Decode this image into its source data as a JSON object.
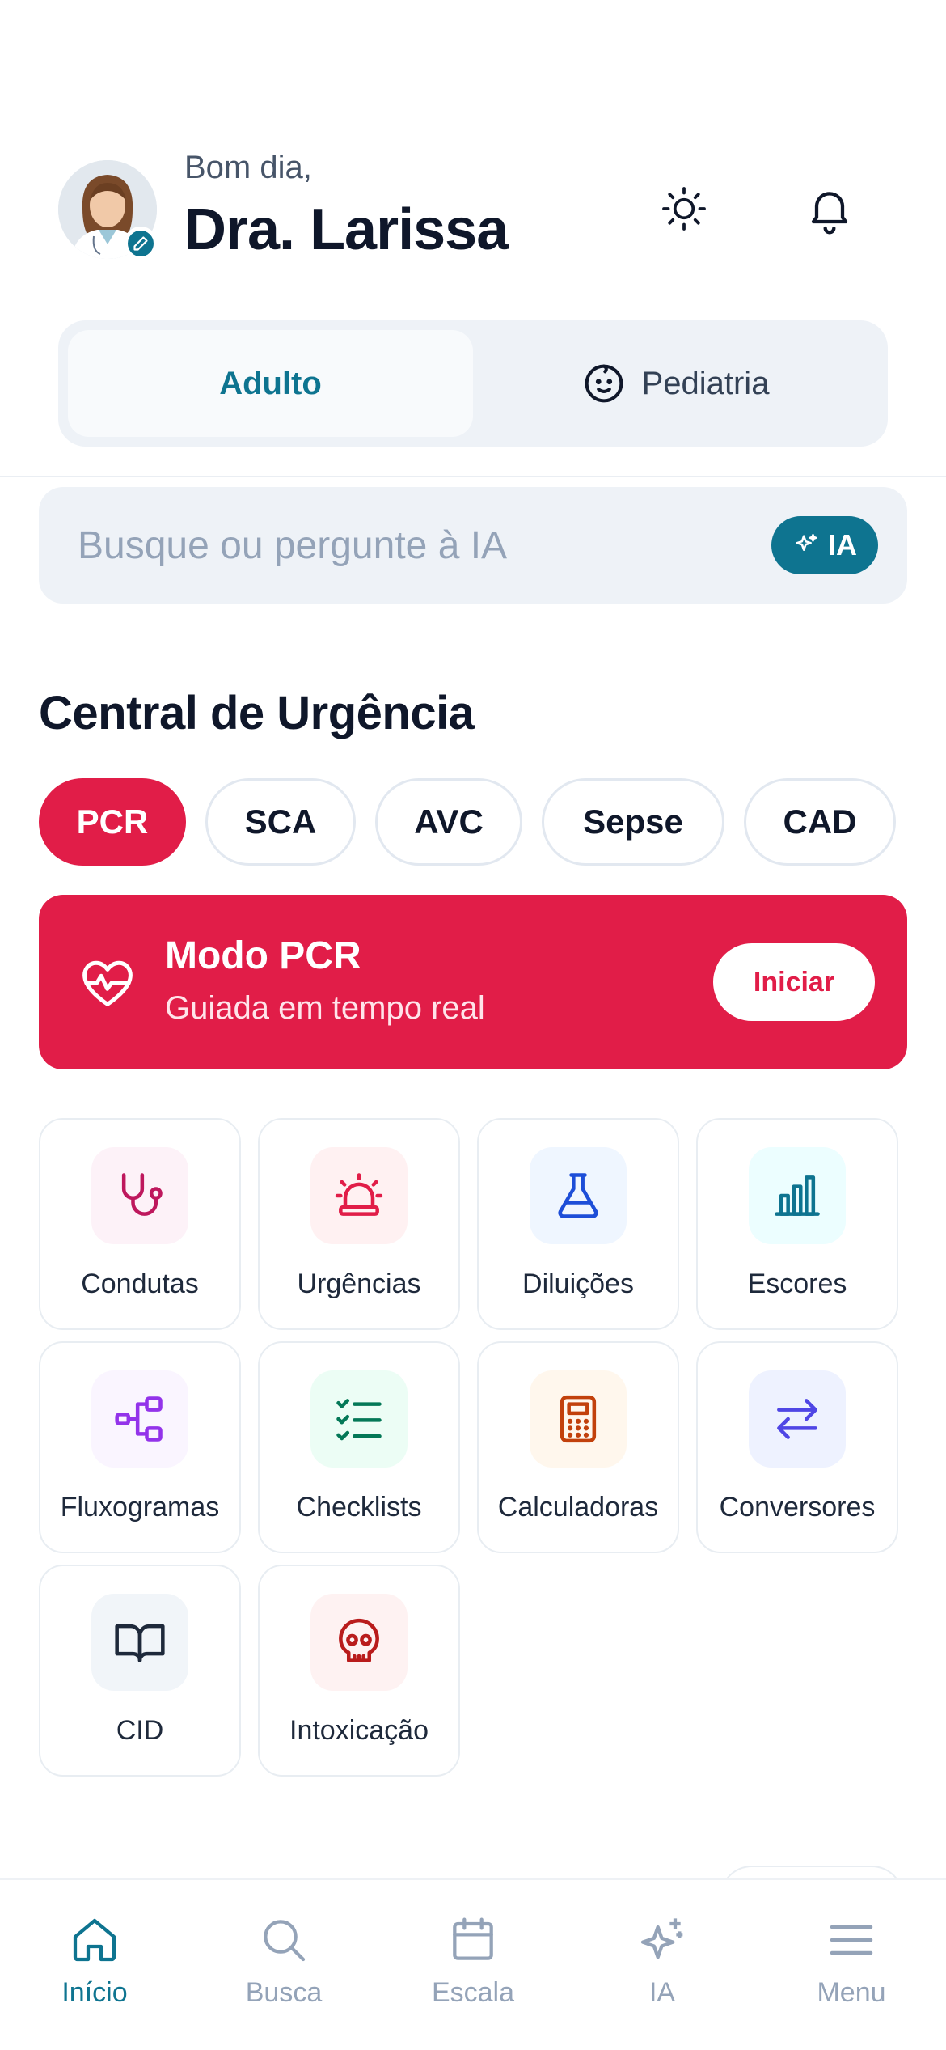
{
  "header": {
    "greeting": "Bom dia,",
    "name": "Dra. Larissa"
  },
  "segment": {
    "tabs": [
      {
        "label": "Adulto",
        "active": true
      },
      {
        "label": "Pediatria",
        "active": false
      }
    ]
  },
  "search": {
    "placeholder": "Busque ou pergunte à IA",
    "ia_label": "IA"
  },
  "section": {
    "title": "Central de Urgência"
  },
  "chips": [
    {
      "label": "PCR",
      "active": true
    },
    {
      "label": "SCA",
      "active": false
    },
    {
      "label": "AVC",
      "active": false
    },
    {
      "label": "Sepse",
      "active": false
    },
    {
      "label": "CAD",
      "active": false
    }
  ],
  "banner": {
    "title": "Modo PCR",
    "subtitle": "Guiada em tempo real",
    "button": "Iniciar"
  },
  "tools": [
    {
      "label": "Condutas",
      "icon": "stethoscope-icon",
      "color": "#be185d",
      "bg": "#fdf2f8"
    },
    {
      "label": "Urgências",
      "icon": "siren-icon",
      "color": "#e11d48",
      "bg": "#fff1f2"
    },
    {
      "label": "Diluições",
      "icon": "flask-icon",
      "color": "#1d4ed8",
      "bg": "#eff6ff"
    },
    {
      "label": "Escores",
      "icon": "bar-chart-icon",
      "color": "#0e7490",
      "bg": "#ecfeff"
    },
    {
      "label": "Fluxogramas",
      "icon": "workflow-icon",
      "color": "#9333ea",
      "bg": "#faf5ff"
    },
    {
      "label": "Checklists",
      "icon": "checklist-icon",
      "color": "#047857",
      "bg": "#ecfdf5"
    },
    {
      "label": "Calculadoras",
      "icon": "calculator-icon",
      "color": "#c2410c",
      "bg": "#fff7ed"
    },
    {
      "label": "Conversores",
      "icon": "swap-icon",
      "color": "#4f46e5",
      "bg": "#eef2ff"
    },
    {
      "label": "CID",
      "icon": "book-icon",
      "color": "#1e293b",
      "bg": "#f1f5f9"
    },
    {
      "label": "Intoxicação",
      "icon": "skull-icon",
      "color": "#b91c1c",
      "bg": "#fef2f2"
    }
  ],
  "nav": [
    {
      "label": "Início",
      "icon": "home-icon",
      "active": true
    },
    {
      "label": "Busca",
      "icon": "search-icon",
      "active": false
    },
    {
      "label": "Escala",
      "icon": "calendar-icon",
      "active": false
    },
    {
      "label": "IA",
      "icon": "sparkles-icon",
      "active": false
    },
    {
      "label": "Menu",
      "icon": "menu-icon",
      "active": false
    }
  ],
  "colors": {
    "accent": "#0e7490",
    "emergency": "#e11d48"
  }
}
